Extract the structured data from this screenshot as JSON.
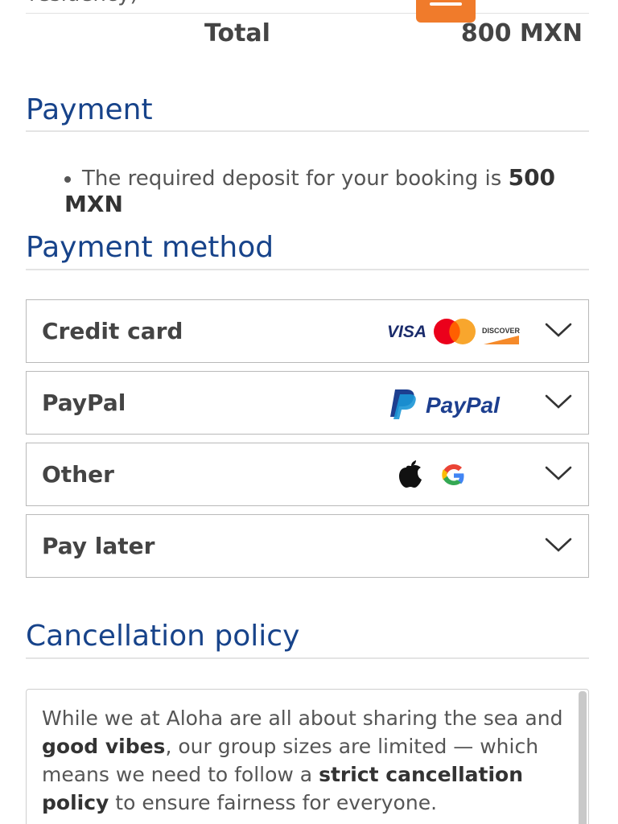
{
  "header": {
    "cut_text": "residency)",
    "menu_icon": "hamburger-menu-icon",
    "accent_color": "#f07b2b"
  },
  "summary": {
    "total_label": "Total",
    "total_value": "800 MXN"
  },
  "payment": {
    "title": "Payment",
    "deposit_text": "The required deposit for your booking is ",
    "deposit_amount": "500 MXN"
  },
  "payment_method": {
    "title": "Payment method",
    "options": [
      {
        "label": "Credit card",
        "logos": [
          "visa-logo",
          "mastercard-logo",
          "discover-logo"
        ],
        "visa_text": "VISA",
        "discover_text": "DISCOVER"
      },
      {
        "label": "PayPal",
        "logos": [
          "paypal-logo"
        ],
        "paypal_text": "PayPal"
      },
      {
        "label": "Other",
        "logos": [
          "apple-logo",
          "google-logo"
        ]
      },
      {
        "label": "Pay later",
        "logos": []
      }
    ],
    "chevron_icon": "chevron-down-icon"
  },
  "cancellation": {
    "title": "Cancellation policy",
    "p1": "While we at Aloha are all about sharing the sea and ",
    "b1": "good vibes",
    "p2": ", our group sizes are limited — which means we need to follow a ",
    "b2": "strict cancellation policy",
    "p3": " to ensure fairness for everyone."
  },
  "colors": {
    "heading": "#17438a",
    "border": "#b9b9b9",
    "text": "#444444"
  }
}
